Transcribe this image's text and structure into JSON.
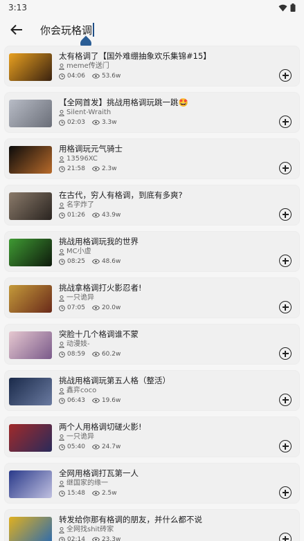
{
  "status": {
    "time": "3:13"
  },
  "search": {
    "query": "你会玩格调"
  },
  "videos": [
    {
      "title": "太有格调了【国外难绷抽象欢乐集锦#15】",
      "author": "meme传送门",
      "duration": "04:06",
      "views": "53.6w",
      "thumb": [
        "#e8a020",
        "#3a2210"
      ]
    },
    {
      "title": "【全网首发】挑战用格调玩跳一跳🤩",
      "author": "Silent-Wraith",
      "duration": "02:03",
      "views": "3.3w",
      "thumb": [
        "#b8bcc6",
        "#6a6e78"
      ]
    },
    {
      "title": "用格调玩元气骑士",
      "author": "13596XC",
      "duration": "21:58",
      "views": "2.3w",
      "thumb": [
        "#0b0b0b",
        "#b86a2a"
      ]
    },
    {
      "title": "在古代，穷人有格调，到底有多爽?",
      "author": "名字炸了",
      "duration": "01:26",
      "views": "43.9w",
      "thumb": [
        "#8a7a6a",
        "#2a2420"
      ]
    },
    {
      "title": "挑战用格调玩我的世界",
      "author": "MC小虚",
      "duration": "08:25",
      "views": "48.6w",
      "thumb": [
        "#3f9a33",
        "#0e1a0c"
      ]
    },
    {
      "title": "挑战拿格调打火影忍者!",
      "author": "一只诡异",
      "duration": "07:05",
      "views": "20.0w",
      "thumb": [
        "#c49a3a",
        "#6a2a1a"
      ]
    },
    {
      "title": "突脸十几个格调谁不蒙",
      "author": "动漫妓-",
      "duration": "08:59",
      "views": "60.2w",
      "thumb": [
        "#e6c8d0",
        "#7a5a8a"
      ]
    },
    {
      "title": "挑战用格调玩第五人格（整活）",
      "author": "鑫弈coco",
      "duration": "06:43",
      "views": "19.6w",
      "thumb": [
        "#1a2a4a",
        "#6a7aa0"
      ]
    },
    {
      "title": "两个人用格调切磋火影!",
      "author": "一只诡异",
      "duration": "05:40",
      "views": "24.7w",
      "thumb": [
        "#a02a2a",
        "#2a2a5a"
      ]
    },
    {
      "title": "全网用格调打瓦第一人",
      "author": "继国家的缘一",
      "duration": "15:48",
      "views": "2.5w",
      "thumb": [
        "#2a3a8a",
        "#c0c0e0"
      ]
    },
    {
      "title": "转发给你那有格调的朋友，并什么都不说",
      "author": "全网找shit砖家",
      "duration": "02:14",
      "views": "23.3w",
      "thumb": [
        "#e0b020",
        "#2a6ab0"
      ]
    }
  ]
}
